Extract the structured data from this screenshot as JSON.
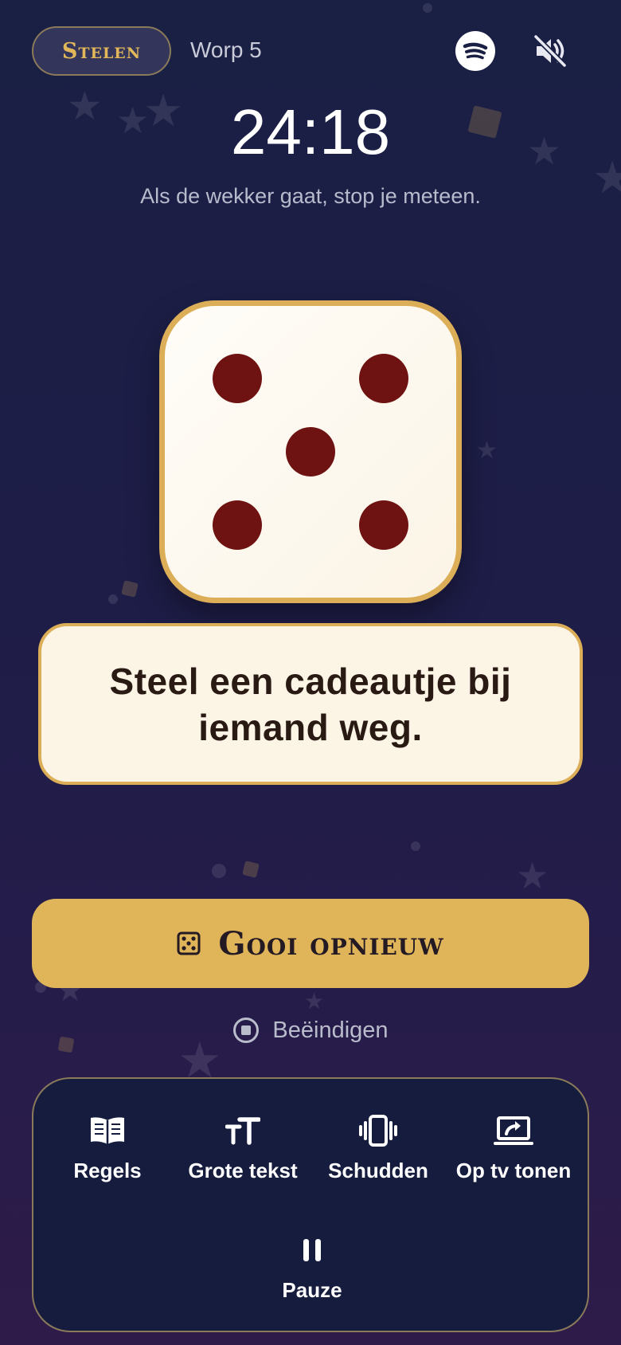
{
  "header": {
    "mode_label": "Stelen",
    "throw_label": "Worp 5",
    "spotify_icon": "spotify-icon",
    "mute_icon": "volume-muted-icon"
  },
  "timer": {
    "time": "24:18",
    "hint": "Als de wekker gaat, stop je meteen."
  },
  "die": {
    "value": 5,
    "face_color": "#fdf8ee",
    "pip_color": "#6f1212",
    "border_color": "#dcae58"
  },
  "action": {
    "text": "Steel een cadeautje bij iemand weg."
  },
  "reroll": {
    "label": "Gooi opnieuw",
    "icon": "dice-icon",
    "color": "#e0b458"
  },
  "end": {
    "label": "Beëindigen",
    "icon": "stop-circle-icon"
  },
  "tools": {
    "rules": {
      "label": "Regels",
      "icon": "book-icon"
    },
    "big_text": {
      "label": "Grote tekst",
      "icon": "text-size-icon"
    },
    "shake": {
      "label": "Schudden",
      "icon": "vibrate-icon"
    },
    "tv": {
      "label": "Op tv tonen",
      "icon": "cast-icon"
    },
    "pause": {
      "label": "Pauze",
      "icon": "pause-icon"
    }
  }
}
